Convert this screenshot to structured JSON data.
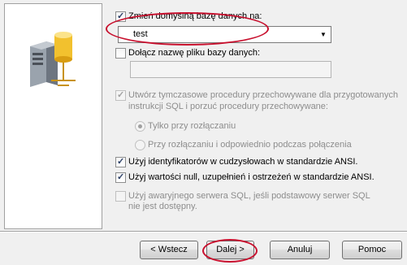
{
  "options": {
    "change_db": {
      "label": "Zmień domyślną bazę danych na:",
      "checked": true
    },
    "database_value": "test",
    "attach_file": {
      "label": "Dołącz nazwę pliku bazy danych:",
      "checked": false
    },
    "attach_file_path": "",
    "temp_procs": {
      "label_line1": "Utwórz tymczasowe procedury przechowywane dla przygotowanych",
      "label_line2": "instrukcji SQL i porzuć procedury przechowywane:",
      "checked": true,
      "enabled": false
    },
    "radio_disconnect": {
      "label": "Tylko przy rozłączaniu",
      "selected": true
    },
    "radio_as_appropriate": {
      "label": "Przy rozłączaniu i odpowiednio podczas połączenia",
      "selected": false
    },
    "quoted_ids": {
      "label": "Użyj identyfikatorów w cudzysłowach w standardzie ANSI.",
      "checked": true
    },
    "ansi_nulls": {
      "label": "Użyj wartości null, uzupełnień i ostrzeżeń w standardzie ANSI.",
      "checked": true
    },
    "failover": {
      "label_line1": "Użyj awaryjnego serwera SQL, jeśli podstawowy serwer SQL",
      "label_line2": "nie jest dostępny.",
      "checked": false,
      "enabled": false
    }
  },
  "buttons": {
    "back": "< Wstecz",
    "next": "Dalej >",
    "cancel": "Anuluj",
    "help": "Pomoc"
  },
  "icons": {
    "illustration": "database-server-icon",
    "dropdown": "chevron-down-icon"
  },
  "colors": {
    "annotation": "#c8102e",
    "cylinder": "#f2c12e"
  }
}
